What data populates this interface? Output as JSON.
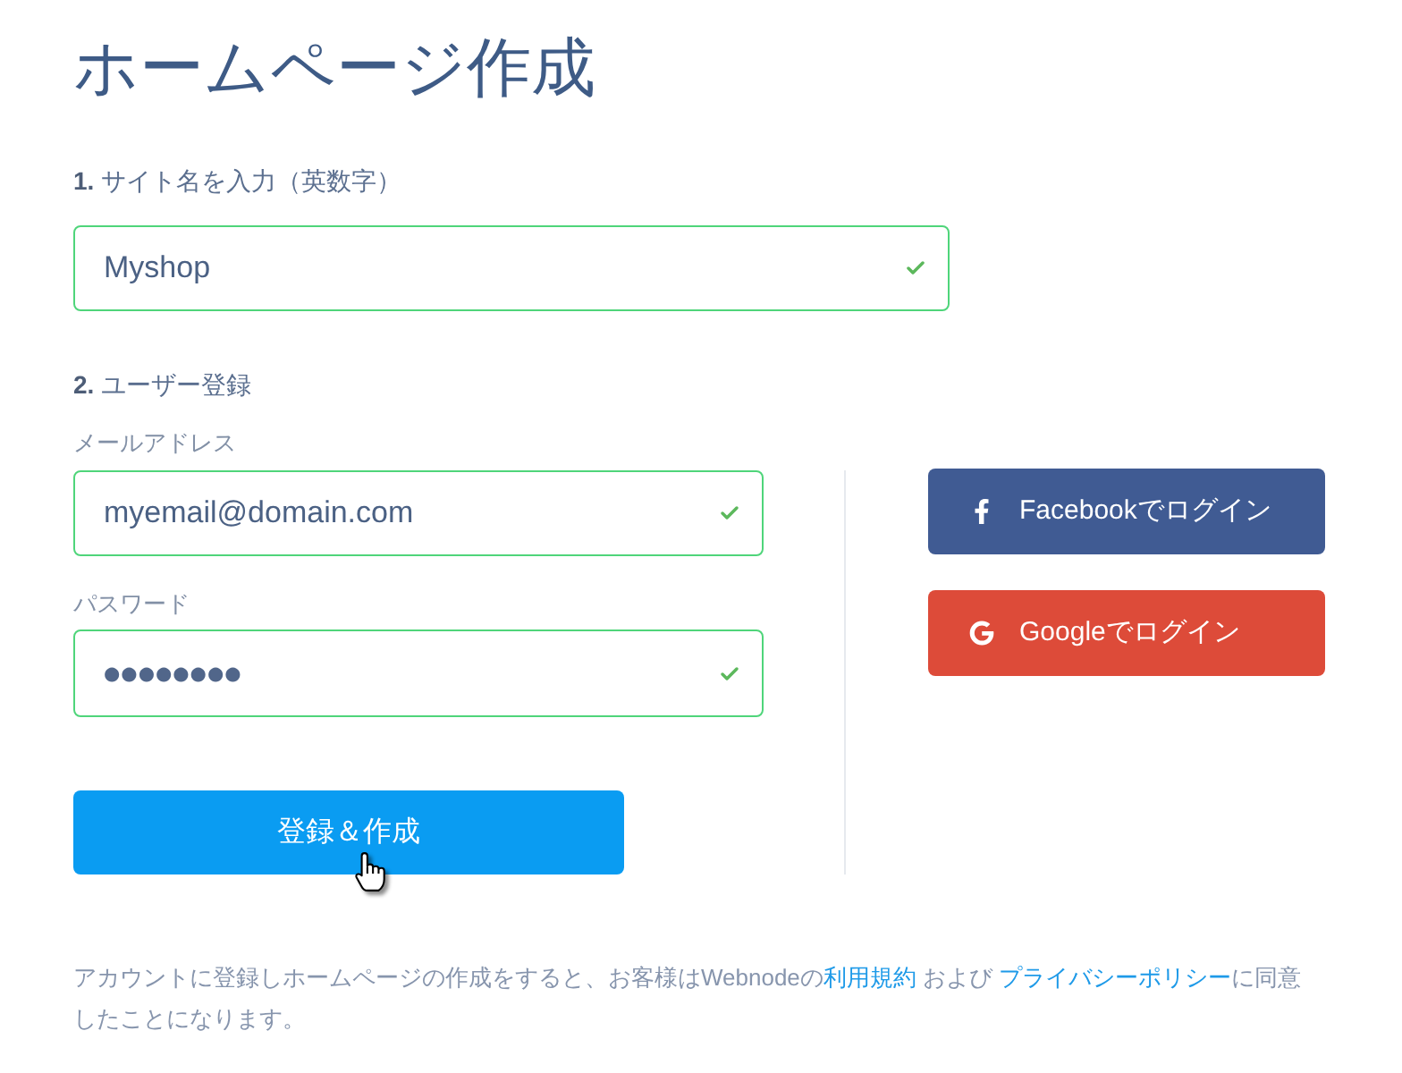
{
  "title": "ホームページ作成",
  "site_step": {
    "number": "1.",
    "label": "サイト名を入力（英数字）",
    "field": {
      "value": "Myshop",
      "valid": true
    }
  },
  "user_step": {
    "number": "2.",
    "label": "ユーザー登録",
    "fields": [
      {
        "label": "メールアドレス",
        "kind": "email",
        "value": "myemail@domain.com",
        "valid": true
      },
      {
        "label": "パスワード",
        "kind": "password",
        "value": "●●●●●●●●",
        "valid": true
      }
    ]
  },
  "submit_button": "登録＆作成",
  "social_buttons": [
    {
      "kind": "facebook",
      "label": "Facebookでログイン"
    },
    {
      "kind": "google",
      "label": "Googleでログイン"
    }
  ],
  "terms": [
    {
      "kind": "text",
      "text": "アカウントに登録しホームページの作成をすると、お客様はWebnodeの"
    },
    {
      "kind": "link",
      "text": "利用規約"
    },
    {
      "kind": "text",
      "text": " および "
    },
    {
      "kind": "link",
      "text": "プライバシーポリシー"
    },
    {
      "kind": "text",
      "text": "に同意したことになります。"
    }
  ]
}
